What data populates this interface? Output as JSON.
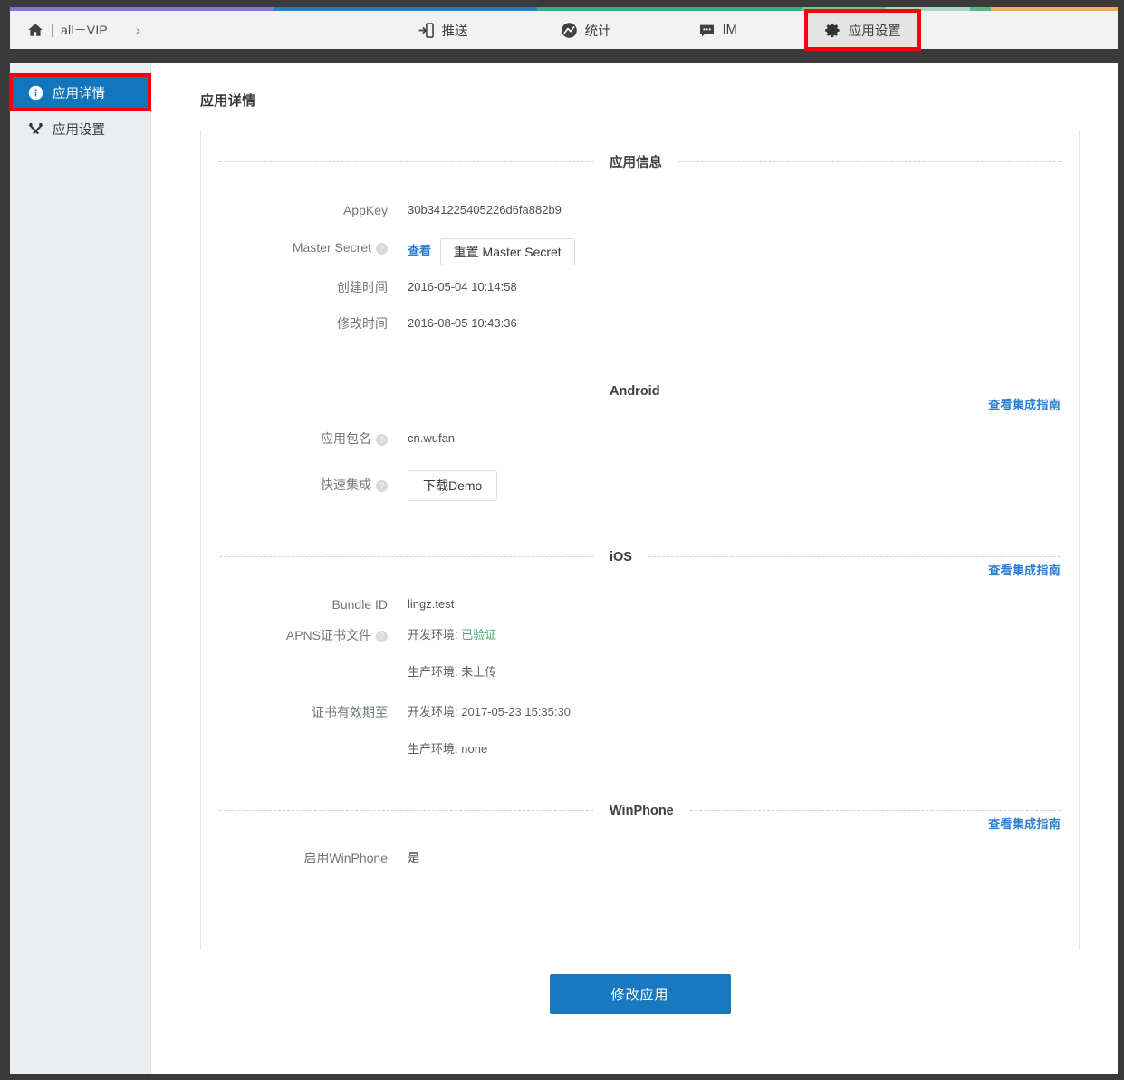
{
  "topbar": {
    "strip_colors": [
      "#8b6fe0",
      "#1b81d0",
      "#2fb07e",
      "#6dc49a",
      "#a9d3bd",
      "#57b98b",
      "#f2ac52"
    ],
    "brand": "all－VIP",
    "caret": "›",
    "nav": [
      {
        "label": "推送",
        "icon": "push-icon",
        "active": false
      },
      {
        "label": "统计",
        "icon": "stats-icon",
        "active": false
      },
      {
        "label": "IM",
        "icon": "im-icon",
        "active": false
      },
      {
        "label": "应用设置",
        "icon": "gear-icon",
        "active": true
      }
    ]
  },
  "sidebar": {
    "items": [
      {
        "label": "应用详情",
        "icon": "info-icon",
        "active": true
      },
      {
        "label": "应用设置",
        "icon": "tools-icon",
        "active": false
      }
    ]
  },
  "main": {
    "page_title": "应用详情",
    "sections": {
      "appinfo": {
        "title": "应用信息",
        "appkey_label": "AppKey",
        "appkey_value": "30b341225405226d6fa882b9",
        "master_secret_label": "Master Secret",
        "master_secret_view": "查看",
        "master_secret_reset": "重置 Master Secret",
        "created_label": "创建时间",
        "created_value": "2016-05-04 10:14:58",
        "modified_label": "修改时间",
        "modified_value": "2016-08-05 10:43:36"
      },
      "android": {
        "title": "Android",
        "guide_link": "查看集成指南",
        "package_label": "应用包名",
        "package_value": "cn.wufan",
        "quickstart_label": "快速集成",
        "download_demo": "下载Demo"
      },
      "ios": {
        "title": "iOS",
        "guide_link": "查看集成指南",
        "bundle_label": "Bundle ID",
        "bundle_value": "lingz.test",
        "apns_label": "APNS证书文件",
        "apns_dev_label": "开发环境:",
        "apns_dev_value": "已验证",
        "apns_prod_label": "生产环境:",
        "apns_prod_value": "未上传",
        "expiry_label": "证书有效期至",
        "expiry_dev_label": "开发环境:",
        "expiry_dev_value": "2017-05-23 15:35:30",
        "expiry_prod_label": "生产环境:",
        "expiry_prod_value": "none"
      },
      "winphone": {
        "title": "WinPhone",
        "guide_link": "查看集成指南",
        "enable_label": "启用WinPhone",
        "enable_value": "是"
      }
    },
    "submit_label": "修改应用"
  },
  "colors": {
    "accent": "#1176bc",
    "link": "#2a7fd4",
    "highlight_box": "#fb0007",
    "success": "#4caf7d",
    "sidebar_bg": "#eaeef0",
    "page_bg": "#3a3a3a"
  },
  "glyphs": {
    "question": "?"
  }
}
